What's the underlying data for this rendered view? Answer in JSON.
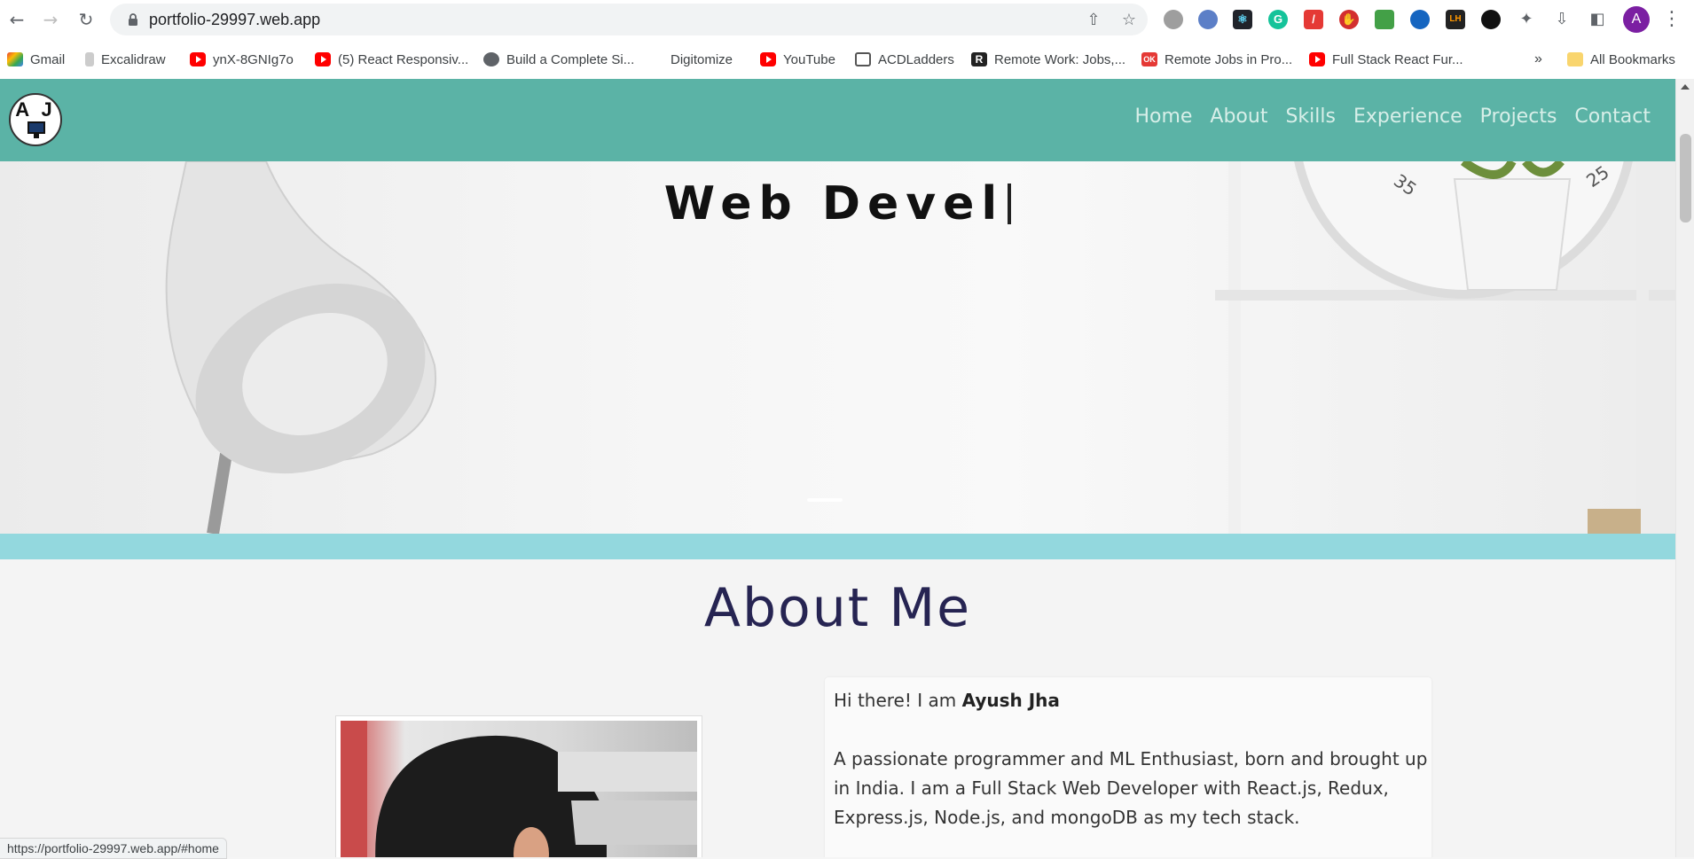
{
  "browser": {
    "url": "portfolio-29997.web.app",
    "profile_initial": "A",
    "status_url": "https://portfolio-29997.web.app/#home"
  },
  "bookmarks": [
    {
      "label": "Gmail",
      "icon": "gmail-icon"
    },
    {
      "label": "Excalidraw",
      "icon": "excalidraw-icon"
    },
    {
      "label": "ynX-8GNIg7o",
      "icon": "youtube-icon"
    },
    {
      "label": "(5) React Responsiv...",
      "icon": "youtube-icon"
    },
    {
      "label": "Build a Complete Si...",
      "icon": "globe-icon"
    },
    {
      "label": "Digitomize",
      "icon": "digitomize-icon"
    },
    {
      "label": "YouTube",
      "icon": "youtube-icon"
    },
    {
      "label": "ACDLadders",
      "icon": "calendar-icon"
    },
    {
      "label": "Remote Work: Jobs,...",
      "icon": "remote-r-icon"
    },
    {
      "label": "Remote Jobs in Pro...",
      "icon": "ok-icon"
    },
    {
      "label": "Full Stack React Fur...",
      "icon": "youtube-icon"
    }
  ],
  "all_bookmarks_label": "All Bookmarks",
  "site": {
    "logo_text": "A J",
    "nav": [
      "Home",
      "About",
      "Skills",
      "Experience",
      "Projects",
      "Contact"
    ],
    "hero_typed": "Web Devel",
    "about_title": "About Me",
    "about_greeting": "Hi there! I am ",
    "about_name": "Ayush Jha",
    "about_paragraph": "A passionate programmer and ML Enthusiast, born and brought up in India. I am a Full Stack Web Developer with React.js, Redux, Express.js, Node.js, and mongoDB as my tech stack."
  },
  "colors": {
    "nav_bg": "#5bb3a6",
    "stripe": "#93d8de",
    "about_title": "#262452"
  }
}
